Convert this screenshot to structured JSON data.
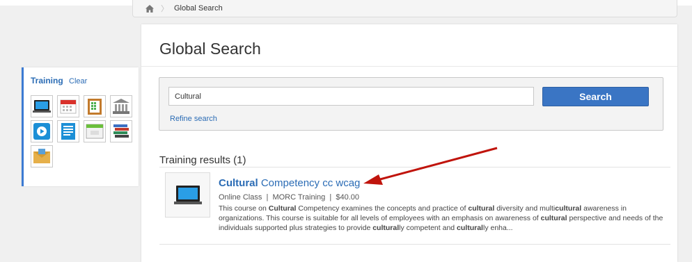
{
  "breadcrumb": {
    "home_icon": "home-icon",
    "current": "Global Search"
  },
  "sidebar": {
    "title": "Training",
    "clear": "Clear",
    "filters": [
      {
        "icon": "laptop-icon"
      },
      {
        "icon": "calendar-icon"
      },
      {
        "icon": "clipboard-icon"
      },
      {
        "icon": "museum-icon"
      },
      {
        "icon": "video-icon"
      },
      {
        "icon": "document-icon"
      },
      {
        "icon": "web-page-icon"
      },
      {
        "icon": "books-icon"
      },
      {
        "icon": "envelope-icon"
      }
    ]
  },
  "page": {
    "title": "Global Search"
  },
  "search": {
    "value": "Cultural",
    "button_label": "Search",
    "refine_label": "Refine search"
  },
  "results": {
    "heading": "Training results (1)",
    "items": [
      {
        "title_highlight": "Cultural",
        "title_rest": " Competency cc wcag",
        "type": "Online Class",
        "provider": "MORC Training",
        "price": "$40.00",
        "description": "This course on Cultural Competency examines the concepts and practice of cultural diversity and multicultural awareness in organizations. This course is suitable for all levels of employees with an emphasis on awareness of cultural perspective and needs of the individuals supported plus strategies to provide culturally competent and culturally enha..."
      }
    ]
  },
  "colors": {
    "accent": "#3a75c4",
    "link": "#2b6cb5",
    "annotation_arrow": "#c0140c"
  }
}
